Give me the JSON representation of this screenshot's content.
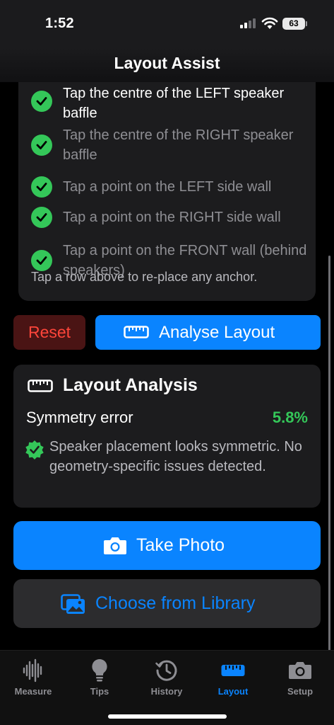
{
  "status": {
    "time": "1:52",
    "battery": "63"
  },
  "nav": {
    "title": "Layout Assist"
  },
  "anchors": {
    "steps": [
      {
        "label": "Tap the centre of the LEFT speaker baffle",
        "done": true
      },
      {
        "label": "Tap the centre of the RIGHT speaker baffle",
        "done": true
      },
      {
        "label": "Tap a point on the LEFT side wall",
        "done": true
      },
      {
        "label": "Tap a point on the RIGHT side wall",
        "done": true
      },
      {
        "label": "Tap a point on the FRONT wall (behind speakers)",
        "done": true
      }
    ],
    "hint": "Tap a row above to re-place any anchor."
  },
  "actions": {
    "reset_label": "Reset",
    "analyse_label": "Analyse Layout"
  },
  "analysis": {
    "title": "Layout Analysis",
    "metric_label": "Symmetry error",
    "metric_value": "5.8%",
    "message": "Speaker placement looks symmetric. No geometry-specific issues detected."
  },
  "photo": {
    "take_label": "Take Photo",
    "library_label": "Choose from Library"
  },
  "tabs": [
    {
      "label": "Measure",
      "icon": "waveform-icon",
      "active": false
    },
    {
      "label": "Tips",
      "icon": "lightbulb-icon",
      "active": false
    },
    {
      "label": "History",
      "icon": "history-icon",
      "active": false
    },
    {
      "label": "Layout",
      "icon": "ruler-icon",
      "active": true
    },
    {
      "label": "Setup",
      "icon": "camera-icon",
      "active": false
    }
  ],
  "colors": {
    "accent": "#0a84ff",
    "success": "#34c759",
    "danger": "#ff453a"
  }
}
